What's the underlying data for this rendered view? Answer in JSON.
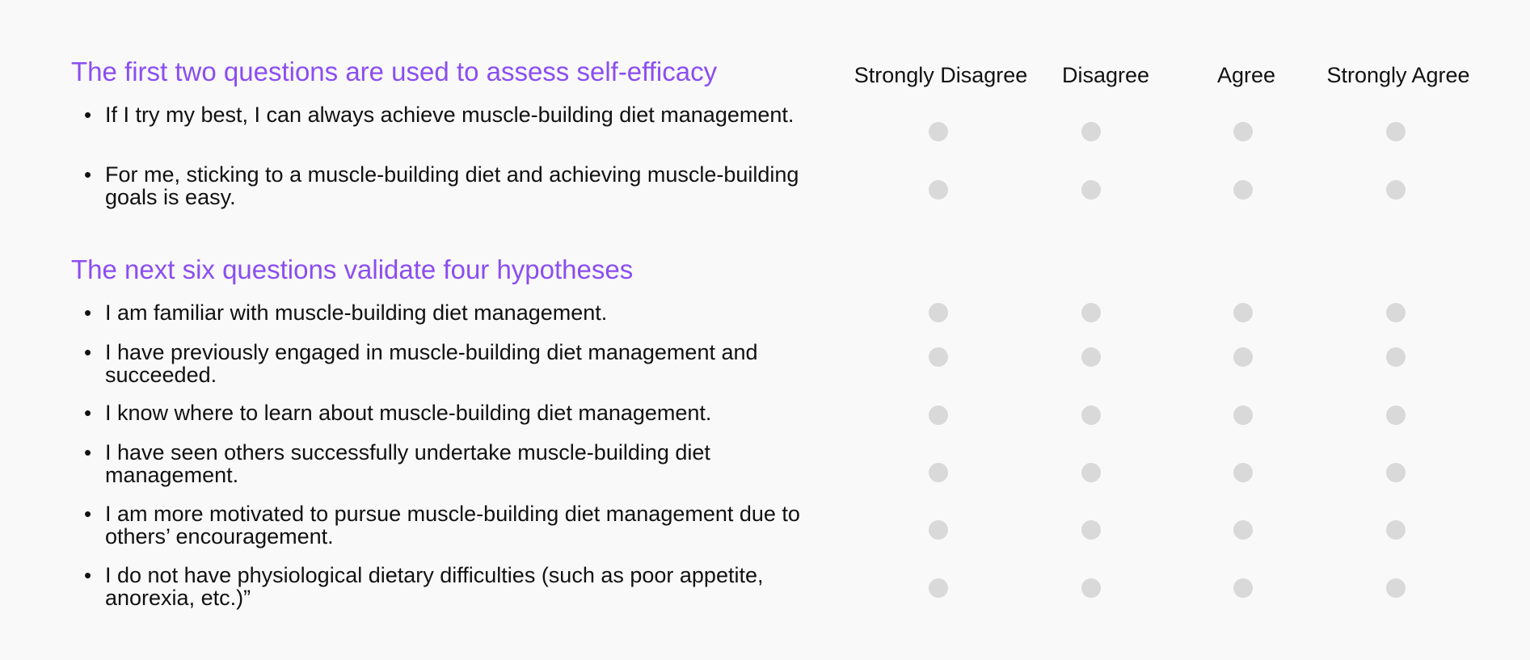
{
  "columns": [
    "Strongly Disagree",
    "Disagree",
    "Agree",
    "Strongly Agree"
  ],
  "sections": [
    {
      "title": "The first two questions are used to assess self-efficacy",
      "questions": [
        "If I try my best, I can always achieve muscle-building diet management.",
        "For me, sticking to a muscle-building diet and achieving muscle-building goals is easy."
      ]
    },
    {
      "title": "The next six questions validate four hypotheses",
      "questions": [
        "I am familiar with muscle-building diet management.",
        "I have previously engaged in muscle-building diet management and succeeded.",
        "I know where to learn about muscle-building diet management.",
        "I have seen others successfully undertake muscle-building diet management.",
        "I am more motivated to pursue muscle-building diet management due to others’ encouragement.",
        "I do not have physiological dietary difficulties (such as poor appetite, anorexia, etc.)”"
      ]
    }
  ],
  "bullet_char": "•",
  "colors": {
    "heading": "#8b4ef0",
    "radio": "#d9d9d9",
    "background": "#f9f9f9"
  }
}
